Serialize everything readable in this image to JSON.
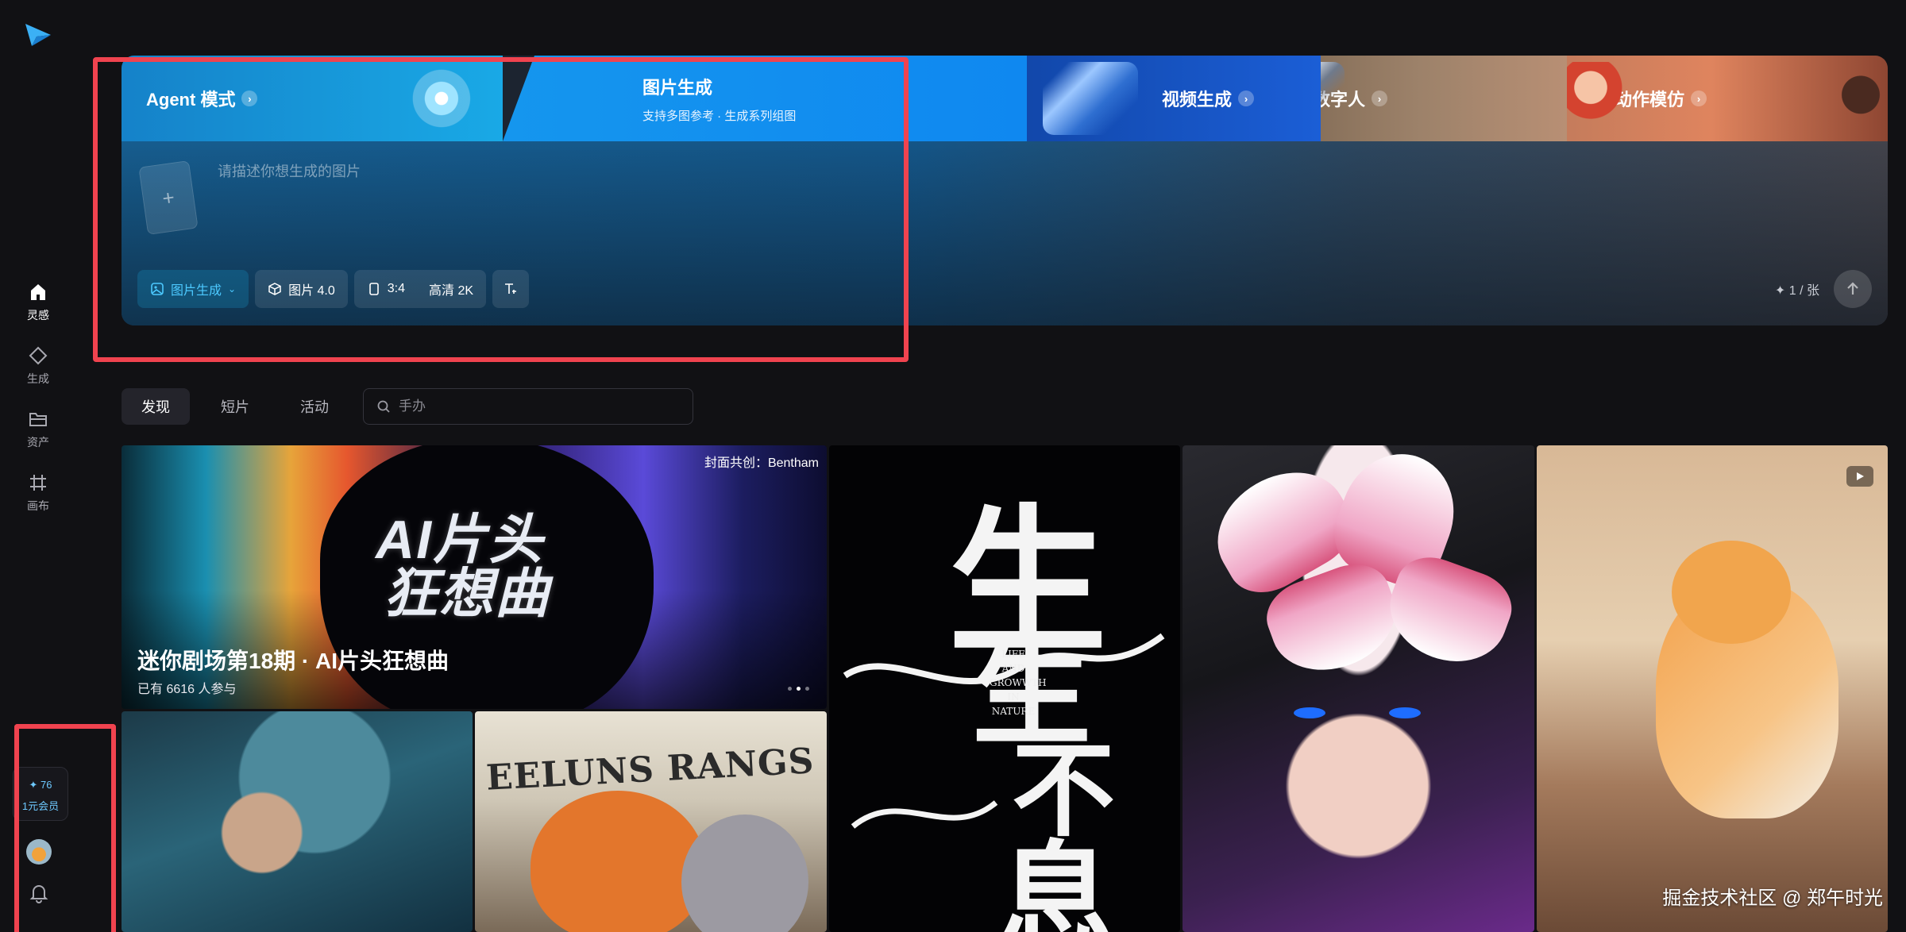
{
  "sidebar": {
    "nav": [
      {
        "label": "灵感",
        "icon": "home-icon",
        "active": true
      },
      {
        "label": "生成",
        "icon": "diamond-icon",
        "active": false
      },
      {
        "label": "资产",
        "icon": "folder-icon",
        "active": false
      },
      {
        "label": "画布",
        "icon": "canvas-icon",
        "active": false
      }
    ],
    "credits": {
      "value": "✦ 76",
      "label": "1元会员"
    }
  },
  "hero": {
    "tabs": [
      {
        "label": "Agent 模式"
      },
      {
        "label": "图片生成",
        "subtitle": "支持多图参考 · 生成系列组图"
      },
      {
        "label": "视频生成"
      },
      {
        "label": "数字人"
      },
      {
        "label": "动作模仿"
      }
    ],
    "prompt_placeholder": "请描述你想生成的图片",
    "toolbar": {
      "mode": "图片生成",
      "model": "图片 4.0",
      "ratio": "3:4",
      "quality": "高清 2K"
    },
    "count": "✦ 1 / 张"
  },
  "filters": {
    "tabs": [
      "发现",
      "短片",
      "活动"
    ],
    "search_placeholder": "手办"
  },
  "gallery": {
    "banner": {
      "credit": "封面共创：Bentham",
      "art_line1": "AI片头",
      "art_line2": "狂想曲",
      "title": "迷你剧场第18期 · AI片头狂想曲",
      "subtitle": "已有 6616 人参与"
    },
    "calligraphy": {
      "chars": [
        "生",
        "生",
        "不",
        "息"
      ],
      "english": "LIFE AND GROWWTH IN NATURE"
    },
    "news_headline": "EELUNS RANGS"
  },
  "watermark": "掘金技术社区 @ 郑午时光",
  "colors": {
    "accent": "#4cc9ff",
    "annotation_red": "#f0434f",
    "background": "#111114"
  }
}
